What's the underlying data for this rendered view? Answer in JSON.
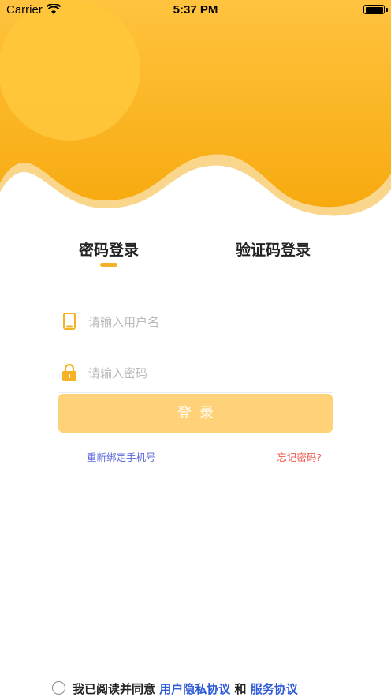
{
  "status_bar": {
    "carrier": "Carrier",
    "time": "5:37 PM"
  },
  "tabs": {
    "password_login": "密码登录",
    "code_login": "验证码登录"
  },
  "form": {
    "username_placeholder": "请输入用户名",
    "password_placeholder": "请输入密码",
    "login_label": "登录"
  },
  "links": {
    "rebind_phone": "重新绑定手机号",
    "forgot_password": "忘记密码?"
  },
  "agreement": {
    "prefix": "我已阅读并同意",
    "privacy_link": "用户隐私协议",
    "and": "和",
    "service_link": "服务协议"
  },
  "colors": {
    "brand_yellow": "#F8B41E",
    "button_disabled": "#FFD27A",
    "link_blue": "#5A66D8",
    "link_red": "#F25B4E",
    "agreement_blue": "#2F5BD6"
  },
  "icons": {
    "username": "phone-icon",
    "password": "lock-icon",
    "wifi": "wifi-icon",
    "battery": "battery-icon"
  }
}
